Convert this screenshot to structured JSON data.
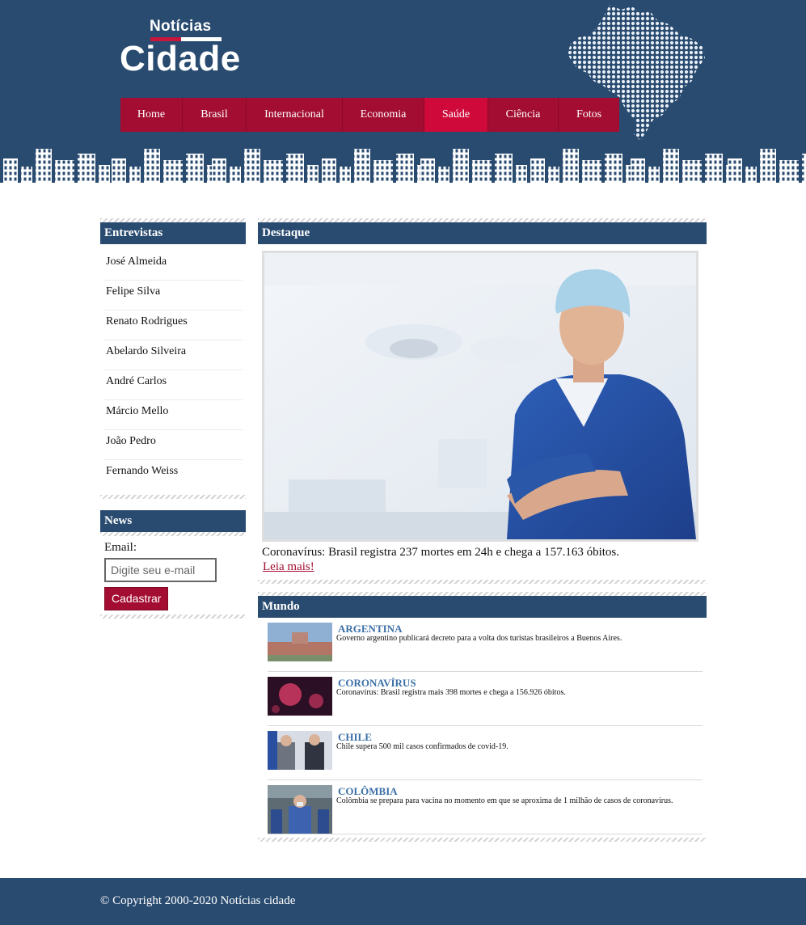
{
  "header": {
    "logo_small": "Notícias",
    "logo_big": "Cidade"
  },
  "nav": {
    "items": [
      {
        "label": "Home"
      },
      {
        "label": "Brasil"
      },
      {
        "label": "Internacional"
      },
      {
        "label": "Economia"
      },
      {
        "label": "Saúde",
        "active": true
      },
      {
        "label": "Ciência"
      },
      {
        "label": "Fotos"
      }
    ]
  },
  "sidebar": {
    "interviews_title": "Entrevistas",
    "interviews": [
      "José Almeida",
      "Felipe Silva",
      "Renato Rodrigues",
      "Abelardo Silveira",
      "André Carlos",
      "Márcio Mello",
      "João Pedro",
      "Fernando Weiss"
    ],
    "news_title": "News",
    "email_label": "Email:",
    "email_placeholder": "Digite seu e-mail",
    "subscribe_label": "Cadastrar"
  },
  "main": {
    "featured_title": "Destaque",
    "featured_caption": "Coronavírus: Brasil registra 237 mortes em 24h e chega a 157.163 óbitos.",
    "featured_link": "Leia mais!",
    "world_title": "Mundo",
    "world_items": [
      {
        "title": "ARGENTINA",
        "text": "Governo argentino publicará decreto para a volta dos turistas brasileiros a Buenos Aires."
      },
      {
        "title": "CORONAVÍRUS",
        "text": "Coronavírus: Brasil registra mais 398 mortes e chega a 156.926 óbitos."
      },
      {
        "title": "CHILE",
        "text": "Chile supera 500 mil casos confirmados de covid-19."
      },
      {
        "title": "COLÔMBIA",
        "text": "Colômbia se prepara para vacina no momento em que se aproxima de 1 milhão de casos de coronavírus."
      }
    ]
  },
  "footer": {
    "copyright": "© Copyright 2000-2020 Notícias cidade"
  },
  "colors": {
    "navy": "#294b70",
    "crimson": "#a30d31",
    "active_red": "#cf0a3b",
    "link_blue": "#3b6fa6"
  }
}
